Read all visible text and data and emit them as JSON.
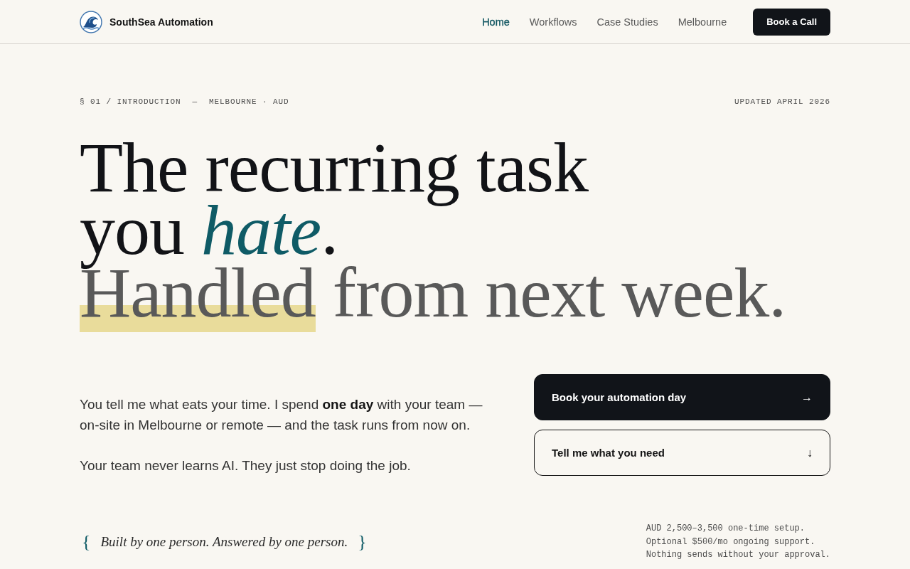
{
  "header": {
    "brand": "SouthSea Automation",
    "nav": [
      {
        "label": "Home",
        "selected": true
      },
      {
        "label": "Workflows",
        "selected": false
      },
      {
        "label": "Case Studies",
        "selected": false
      },
      {
        "label": "Melbourne",
        "selected": false
      }
    ],
    "cta": "Book a Call"
  },
  "intro": {
    "section": "§ 01 / INTRODUCTION",
    "divider": "—",
    "location": "MELBOURNE · AUD",
    "updated": "UPDATED APRIL 2026"
  },
  "headline": {
    "lines": [
      {
        "muted": false,
        "segments": [
          {
            "kind": "plain",
            "text": "The recurring task"
          }
        ]
      },
      {
        "muted": false,
        "segments": [
          {
            "kind": "plain",
            "text": "you "
          },
          {
            "kind": "accent",
            "text": "hate"
          },
          {
            "kind": "plain",
            "text": "."
          }
        ]
      },
      {
        "muted": true,
        "segments": [
          {
            "kind": "highlight",
            "text": "Handled"
          },
          {
            "kind": "plain",
            "text": " from next week."
          }
        ]
      }
    ]
  },
  "body": {
    "paragraphs": [
      "You tell me what eats your time. I spend **one day** with your team — on-site in Melbourne or remote — and the task runs from now on.",
      "Your team never learns AI. They just stop doing the job."
    ]
  },
  "actions": [
    {
      "kind": "primary",
      "label": "Book your automation day",
      "arrow": "→"
    },
    {
      "kind": "secondary",
      "label": "Tell me what you need",
      "arrow": "↓"
    }
  ],
  "quote": {
    "open": "{",
    "text": "Built by one person. Answered by one person.",
    "close": "}"
  },
  "pricing": [
    "AUD 2,500–3,500 one-time setup.",
    "Optional $500/mo ongoing support.",
    "Nothing sends without your approval."
  ]
}
